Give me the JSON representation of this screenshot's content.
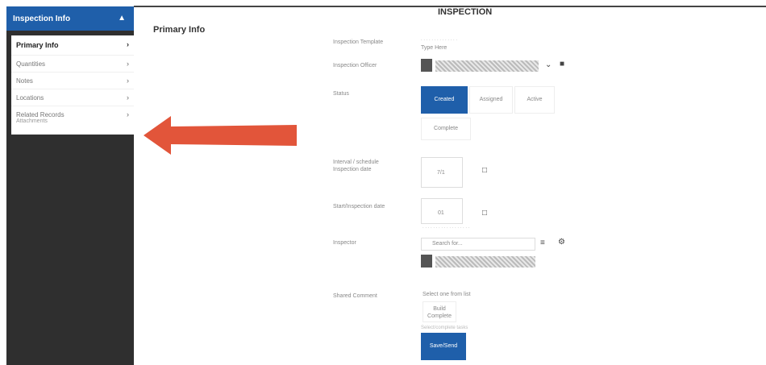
{
  "sidebar": {
    "header": "Inspection Info",
    "items": [
      {
        "label": "Primary Info"
      },
      {
        "label": "Quantities"
      },
      {
        "label": "Notes"
      },
      {
        "label": "Locations"
      },
      {
        "label": "Related Records"
      }
    ],
    "subitem": "Attachments"
  },
  "page_title": "INSPECTION",
  "section_title": "Primary Info",
  "form": {
    "labels": {
      "type": "Inspection Template",
      "inspector": "Inspection Officer",
      "status": "Status",
      "interval": "Interval / schedule Inspection date",
      "date": "Start/Inspection date",
      "inspector2": "Inspector",
      "result": "Shared Comment"
    },
    "type_value": "Type Here",
    "status_options": [
      "Created",
      "Assigned",
      "Active",
      "Complete"
    ],
    "interval_value": "7/1",
    "date_value": "01",
    "inspector_placeholder": "Search for...",
    "result_hint": "Select one from list",
    "result_option": "Build Complete",
    "submit_label": "Save/Send",
    "note_text": "Select/complete tasks"
  }
}
